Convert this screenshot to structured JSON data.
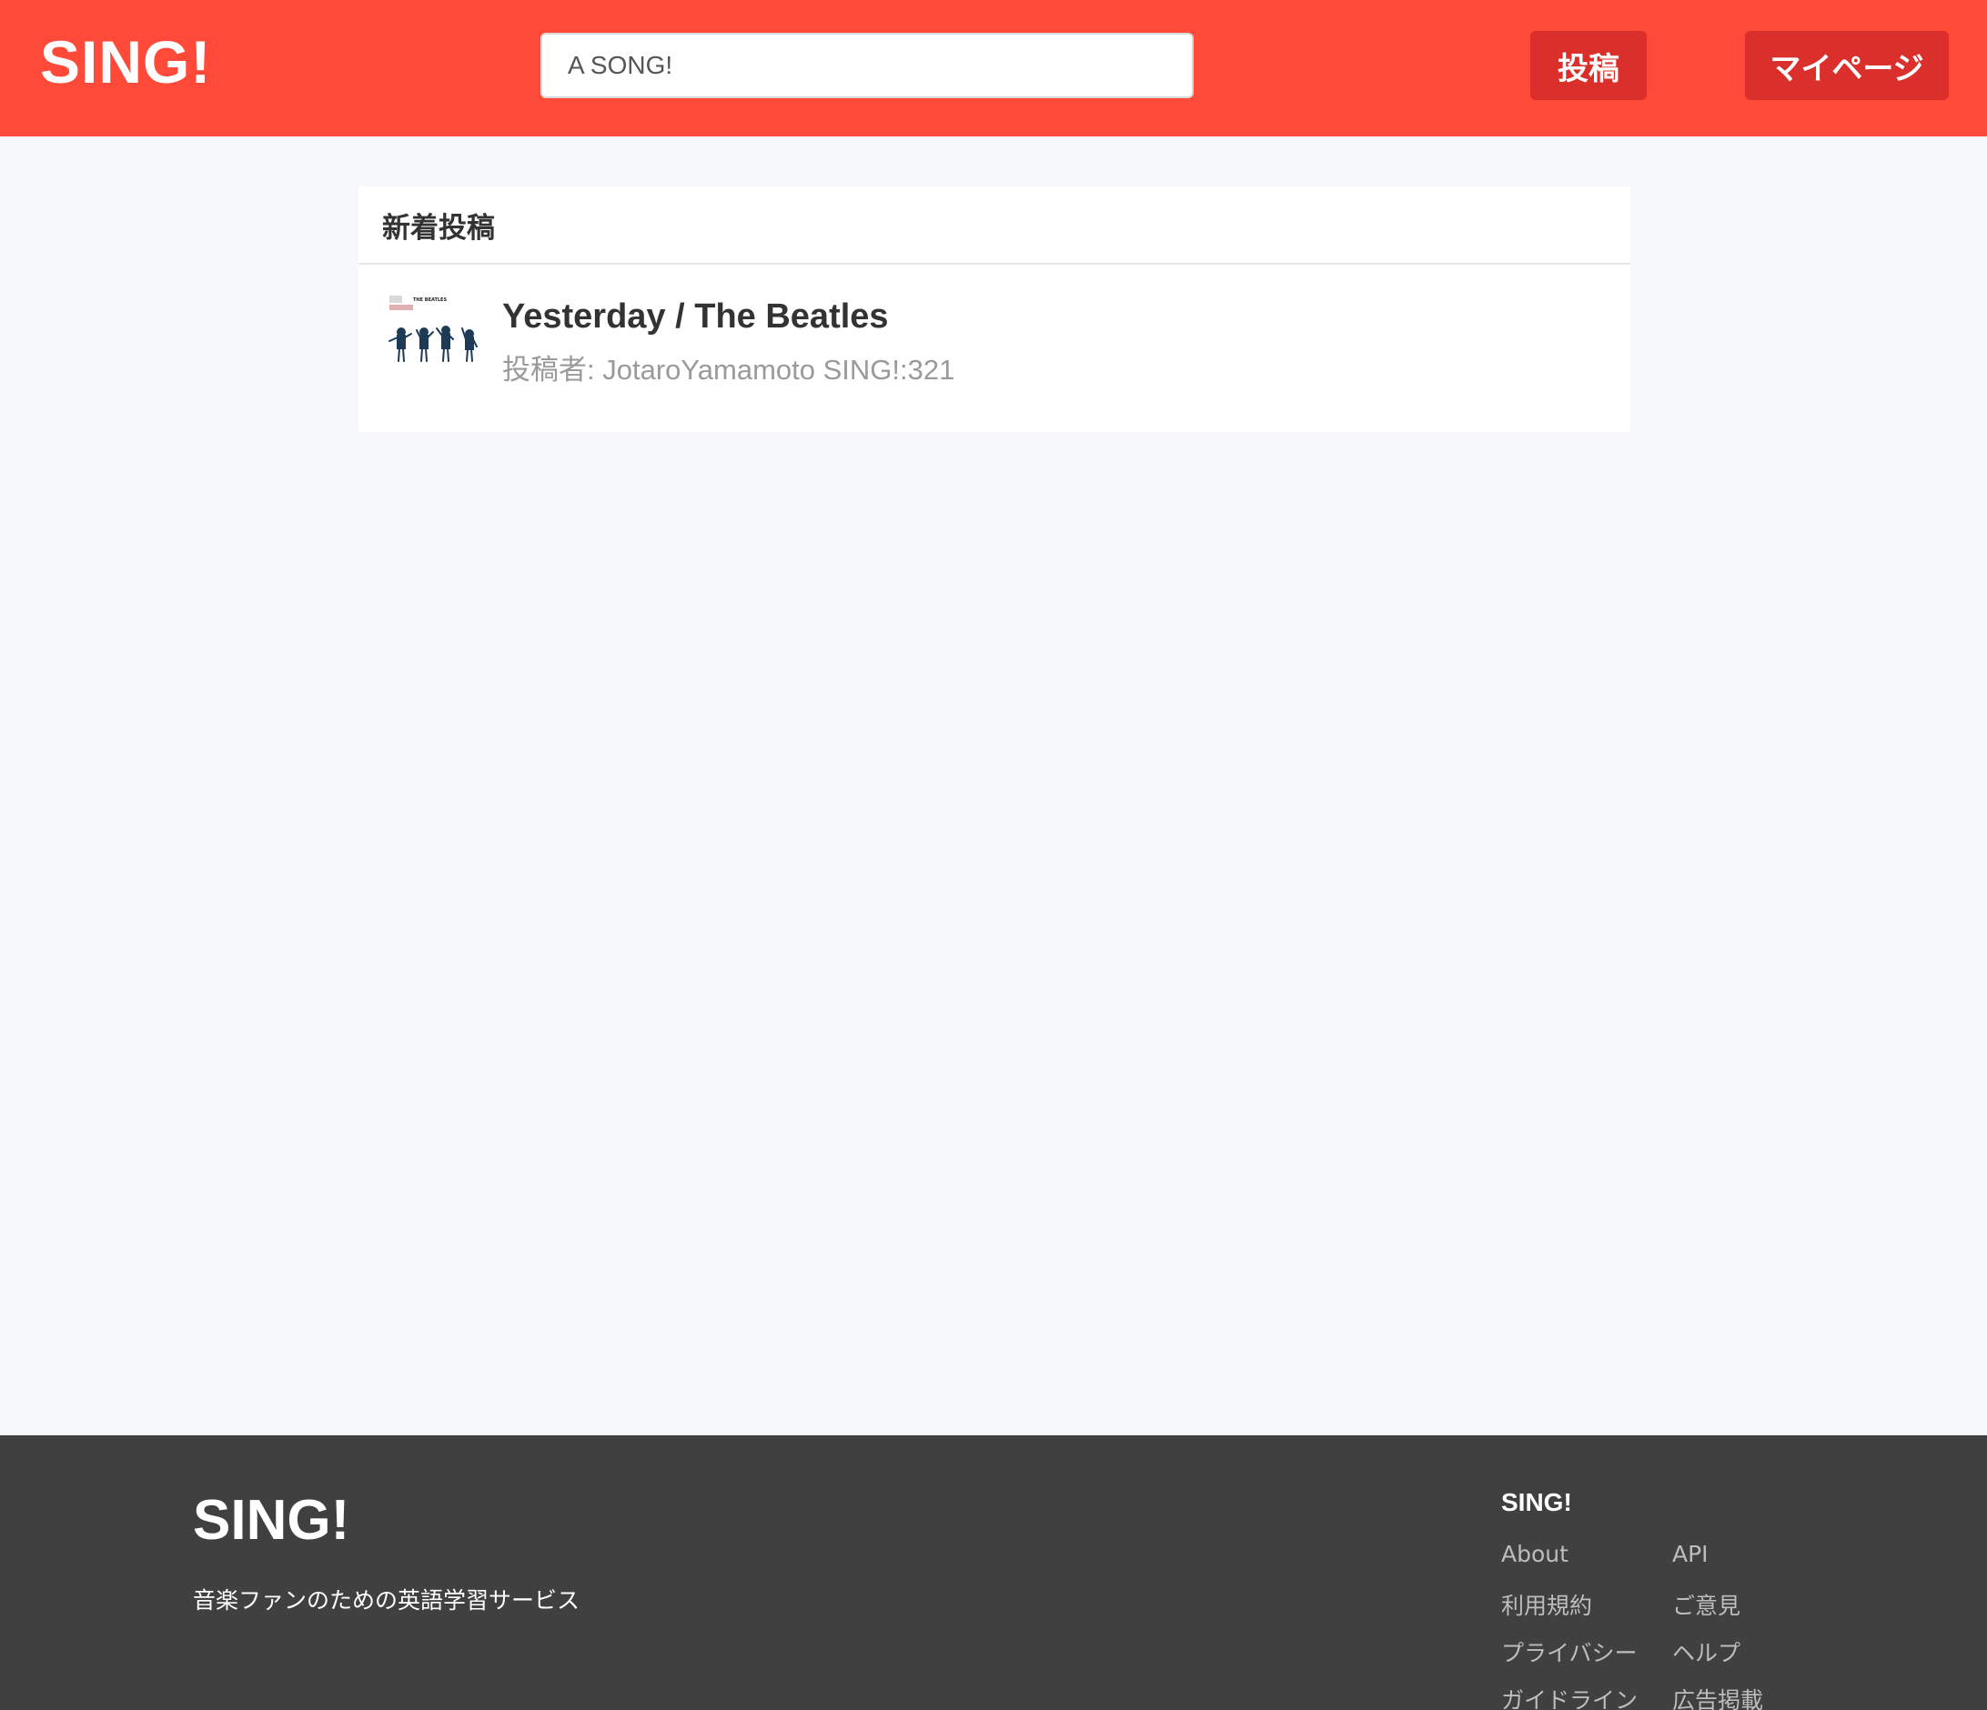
{
  "header": {
    "logo": "SING!",
    "search_value": "A SONG!",
    "post_button": "投稿",
    "mypage_button": "マイページ",
    "brand_color": "#ff4a39"
  },
  "main": {
    "section_title": "新着投稿",
    "posts": [
      {
        "title": "Yesterday / The Beatles",
        "meta": "投稿者: JotaroYamamoto SING!:321",
        "thumbnail_label": "THE BEATLES"
      }
    ]
  },
  "footer": {
    "logo": "SING!",
    "tagline": "音楽ファンのための英語学習サービス",
    "links_heading": "SING!",
    "links_left": [
      "About",
      "利用規約",
      "プライバシー",
      "ガイドライン"
    ],
    "links_right": [
      "API",
      "ご意見",
      "ヘルプ",
      "広告掲載"
    ]
  }
}
